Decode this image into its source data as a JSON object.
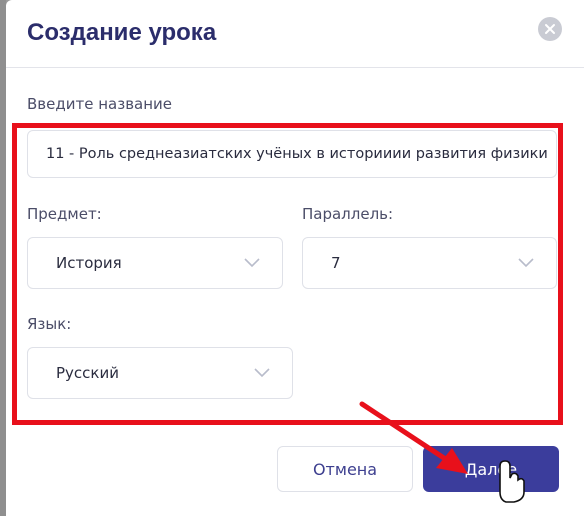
{
  "dialog": {
    "title": "Создание урока",
    "name_label": "Введите название",
    "name_value": "11 - Роль среднеазиатских учёных в историиии развития физики",
    "subject_label": "Предмет:",
    "subject_value": "История",
    "parallel_label": "Параллель:",
    "parallel_value": "7",
    "language_label": "Язык:",
    "language_value": "Русский",
    "cancel_label": "Отмена",
    "next_label": "Далее"
  },
  "colors": {
    "title": "#2b2d6b",
    "primary_button": "#3b3d9c",
    "highlight": "#e8101b"
  },
  "icons": [
    "close-icon",
    "chevron-down-icon",
    "arrow-annotation",
    "hand-cursor-icon"
  ]
}
